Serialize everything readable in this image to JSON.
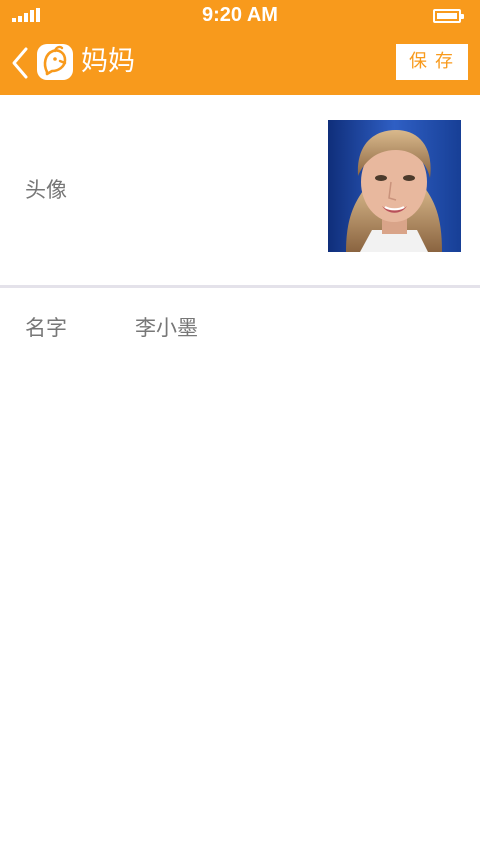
{
  "status_bar": {
    "time": "9:20 AM",
    "signal_icon": "signal-icon",
    "battery_icon": "battery-icon"
  },
  "header": {
    "back_icon": "chevron-left-icon",
    "logo_icon": "app-logo-icon",
    "title": "妈妈",
    "save_label": "保存"
  },
  "profile": {
    "avatar_label": "头像",
    "name_label": "名字",
    "name_value": "李小墨"
  },
  "colors": {
    "accent": "#f89a1c",
    "divider": "#e4e2ea",
    "label_text": "#777777"
  }
}
